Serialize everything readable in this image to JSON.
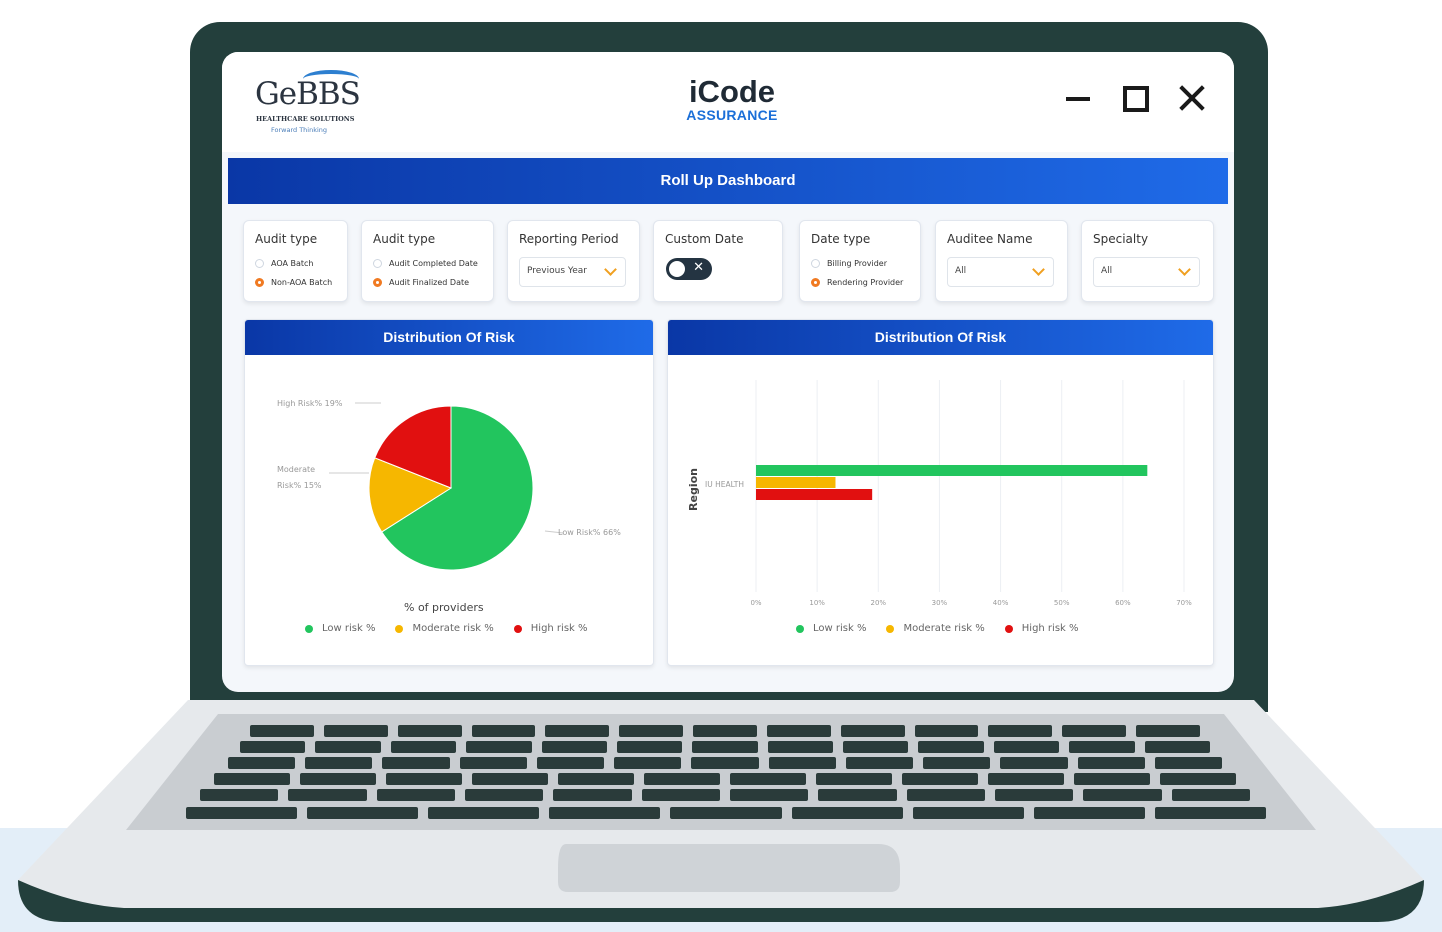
{
  "colors": {
    "low": "#22c55e",
    "moderate": "#f6b700",
    "high": "#e11010",
    "header": "#0a37a6",
    "accent": "#f07a22"
  },
  "branding": {
    "gebbs_name": "GeBBS",
    "gebbs_sub": "HEALTHCARE SOLUTIONS",
    "gebbs_tag": "Forward Thinking",
    "icode_main": "iCode",
    "icode_sub": "ASSURANCE"
  },
  "window": {
    "icons": [
      "minimize-icon",
      "maximize-icon",
      "close-icon"
    ]
  },
  "dashboard": {
    "title": "Roll Up Dashboard"
  },
  "filters": {
    "audit_type_1": {
      "title": "Audit type",
      "options": [
        "AOA Batch",
        "Non-AOA Batch"
      ],
      "selected": "Non-AOA Batch"
    },
    "audit_type_2": {
      "title": "Audit type",
      "options": [
        "Audit Completed Date",
        "Audit Finalized Date"
      ],
      "selected": "Audit Finalized Date"
    },
    "reporting_period": {
      "title": "Reporting Period",
      "value": "Previous Year"
    },
    "custom_date": {
      "title": "Custom Date",
      "toggle_on": false
    },
    "date_type": {
      "title": "Date type",
      "options": [
        "Billing Provider",
        "Rendering Provider"
      ],
      "selected": "Rendering Provider"
    },
    "auditee_name": {
      "title": "Auditee Name",
      "value": "All"
    },
    "specialty": {
      "title": "Specialty",
      "value": "All"
    }
  },
  "pie_card": {
    "title": "Distribution Of Risk",
    "slice_labels": {
      "high": "High Risk% 19%",
      "moderate_line1": "Moderate",
      "moderate_line2": "Risk% 15%",
      "low": "Low Risk% 66%"
    },
    "axis_caption": "% of providers"
  },
  "bar_card": {
    "title": "Distribution Of Risk",
    "y_axis_label": "Region",
    "category": "IU HEALTH"
  },
  "legend": {
    "low": "Low risk %",
    "moderate": "Moderate risk %",
    "high": "High risk %"
  },
  "chart_data": [
    {
      "type": "pie",
      "title": "Distribution Of Risk",
      "labels": [
        "Low risk %",
        "Moderate risk %",
        "High risk %"
      ],
      "values": [
        66,
        15,
        19
      ],
      "xlabel": "% of providers",
      "legend": "bottom"
    },
    {
      "type": "bar",
      "orientation": "horizontal",
      "title": "Distribution Of Risk",
      "categories": [
        "IU HEALTH"
      ],
      "series": [
        {
          "name": "Low risk %",
          "values": [
            64
          ]
        },
        {
          "name": "Moderate risk %",
          "values": [
            13
          ]
        },
        {
          "name": "High risk %",
          "values": [
            19
          ]
        }
      ],
      "ylabel": "Region",
      "xlim": [
        0,
        70
      ],
      "xticks": [
        "0%",
        "10%",
        "20%",
        "30%",
        "40%",
        "50%",
        "60%",
        "70%"
      ],
      "grid": true,
      "legend": "bottom"
    }
  ]
}
